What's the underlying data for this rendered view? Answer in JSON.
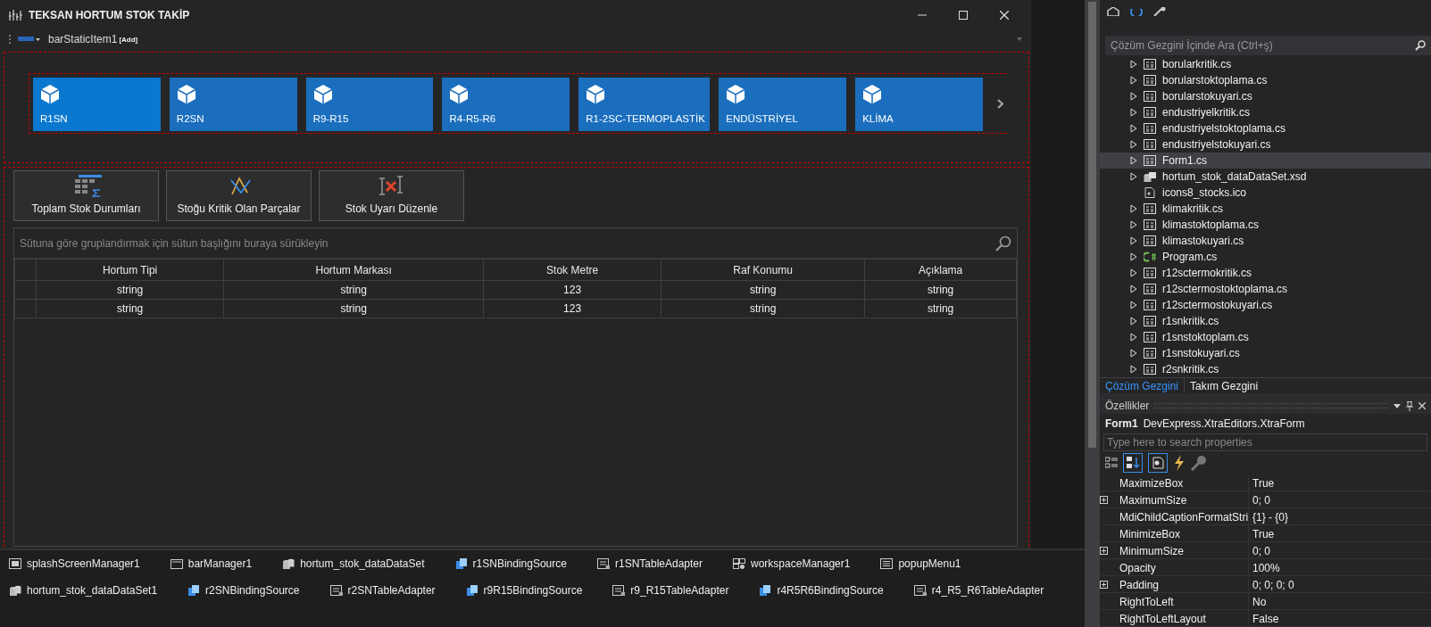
{
  "window": {
    "title": "TEKSAN HORTUM STOK TAKİP"
  },
  "toolbar": {
    "item_label": "barStaticItem1",
    "add_badge": "[Add]"
  },
  "tiles": [
    {
      "label": "R1SN",
      "selected": true
    },
    {
      "label": "R2SN",
      "selected": false
    },
    {
      "label": "R9-R15",
      "selected": false
    },
    {
      "label": "R4-R5-R6",
      "selected": false
    },
    {
      "label": "R1-2SC-TERMOPLASTİK",
      "selected": false
    },
    {
      "label": "ENDÜSTRİYEL",
      "selected": false
    },
    {
      "label": "KLİMA",
      "selected": false
    }
  ],
  "action_buttons": [
    {
      "label": "Toplam Stok Durumları",
      "kind": "table"
    },
    {
      "label": "Stoğu Kritik Olan Parçalar",
      "kind": "chart"
    },
    {
      "label": "Stok Uyarı Düzenle",
      "kind": "alert"
    }
  ],
  "grid": {
    "group_panel_placeholder": "Sütuna göre gruplandırmak için sütun başlığını buraya sürükleyin",
    "columns": [
      "Hortum Tipi",
      "Hortum Markası",
      "Stok Metre",
      "Raf Konumu",
      "Açıklama"
    ],
    "rows": [
      [
        "string",
        "string",
        "123",
        "string",
        "string"
      ],
      [
        "string",
        "string",
        "123",
        "string",
        "string"
      ]
    ]
  },
  "component_tray": [
    [
      {
        "label": "splashScreenManager1",
        "kind": "window"
      },
      {
        "label": "barManager1",
        "kind": "bar"
      },
      {
        "label": "hortum_stok_dataDataSet",
        "kind": "dataset"
      },
      {
        "label": "r1SNBindingSource",
        "kind": "binding"
      },
      {
        "label": "r1SNTableAdapter",
        "kind": "adapter"
      },
      {
        "label": "workspaceManager1",
        "kind": "workspace"
      },
      {
        "label": "popupMenu1",
        "kind": "menu"
      }
    ],
    [
      {
        "label": "hortum_stok_dataDataSet1",
        "kind": "dataset"
      },
      {
        "label": "r2SNBindingSource",
        "kind": "binding"
      },
      {
        "label": "r2SNTableAdapter",
        "kind": "adapter"
      },
      {
        "label": "r9R15BindingSource",
        "kind": "binding"
      },
      {
        "label": "r9_R15TableAdapter",
        "kind": "adapter"
      },
      {
        "label": "r4R5R6BindingSource",
        "kind": "binding"
      },
      {
        "label": "r4_R5_R6TableAdapter",
        "kind": "adapter"
      }
    ]
  ],
  "solution_explorer": {
    "search_placeholder": "Çözüm Gezgini İçinde Ara (Ctrl+ş)",
    "items": [
      {
        "label": "borularkritik.cs",
        "kind": "form",
        "expandable": true,
        "selected": false
      },
      {
        "label": "borularstoktoplama.cs",
        "kind": "form",
        "expandable": true,
        "selected": false
      },
      {
        "label": "borularstokuyari.cs",
        "kind": "form",
        "expandable": true,
        "selected": false
      },
      {
        "label": "endustriyelkritik.cs",
        "kind": "form",
        "expandable": true,
        "selected": false
      },
      {
        "label": "endustriyelstoktoplama.cs",
        "kind": "form",
        "expandable": true,
        "selected": false
      },
      {
        "label": "endustriyelstokuyari.cs",
        "kind": "form",
        "expandable": true,
        "selected": false
      },
      {
        "label": "Form1.cs",
        "kind": "form",
        "expandable": true,
        "selected": true
      },
      {
        "label": "hortum_stok_dataDataSet.xsd",
        "kind": "dataset",
        "expandable": true,
        "selected": false
      },
      {
        "label": "icons8_stocks.ico",
        "kind": "file",
        "expandable": false,
        "selected": false
      },
      {
        "label": "klimakritik.cs",
        "kind": "form",
        "expandable": true,
        "selected": false
      },
      {
        "label": "klimastoktoplama.cs",
        "kind": "form",
        "expandable": true,
        "selected": false
      },
      {
        "label": "klimastokuyari.cs",
        "kind": "form",
        "expandable": true,
        "selected": false
      },
      {
        "label": "Program.cs",
        "kind": "csharp",
        "expandable": true,
        "selected": false
      },
      {
        "label": "r12sctermokritik.cs",
        "kind": "form",
        "expandable": true,
        "selected": false
      },
      {
        "label": "r12sctermostoktoplama.cs",
        "kind": "form",
        "expandable": true,
        "selected": false
      },
      {
        "label": "r12sctermostokuyari.cs",
        "kind": "form",
        "expandable": true,
        "selected": false
      },
      {
        "label": "r1snkritik.cs",
        "kind": "form",
        "expandable": true,
        "selected": false
      },
      {
        "label": "r1snstoktoplam.cs",
        "kind": "form",
        "expandable": true,
        "selected": false
      },
      {
        "label": "r1snstokuyari.cs",
        "kind": "form",
        "expandable": true,
        "selected": false
      },
      {
        "label": "r2snkritik.cs",
        "kind": "form",
        "expandable": true,
        "selected": false
      }
    ],
    "tabs": [
      {
        "label": "Çözüm Gezgini",
        "selected": true
      },
      {
        "label": "Takım Gezgini",
        "selected": false
      }
    ]
  },
  "properties": {
    "title": "Özellikler",
    "object_name": "Form1",
    "object_type": "DevExpress.XtraEditors.XtraForm",
    "search_placeholder": "Type here to search properties",
    "rows": [
      {
        "name": "MaximizeBox",
        "value": "True",
        "expandable": false
      },
      {
        "name": "MaximumSize",
        "value": "0; 0",
        "expandable": true
      },
      {
        "name": "MdiChildCaptionFormatStri",
        "value": "{1} - {0}",
        "expandable": false
      },
      {
        "name": "MinimizeBox",
        "value": "True",
        "expandable": false
      },
      {
        "name": "MinimumSize",
        "value": "0; 0",
        "expandable": true
      },
      {
        "name": "Opacity",
        "value": "100%",
        "expandable": false
      },
      {
        "name": "Padding",
        "value": "0; 0; 0; 0",
        "expandable": true
      },
      {
        "name": "RightToLeft",
        "value": "No",
        "expandable": false
      },
      {
        "name": "RightToLeftLayout",
        "value": "False",
        "expandable": false
      }
    ]
  }
}
